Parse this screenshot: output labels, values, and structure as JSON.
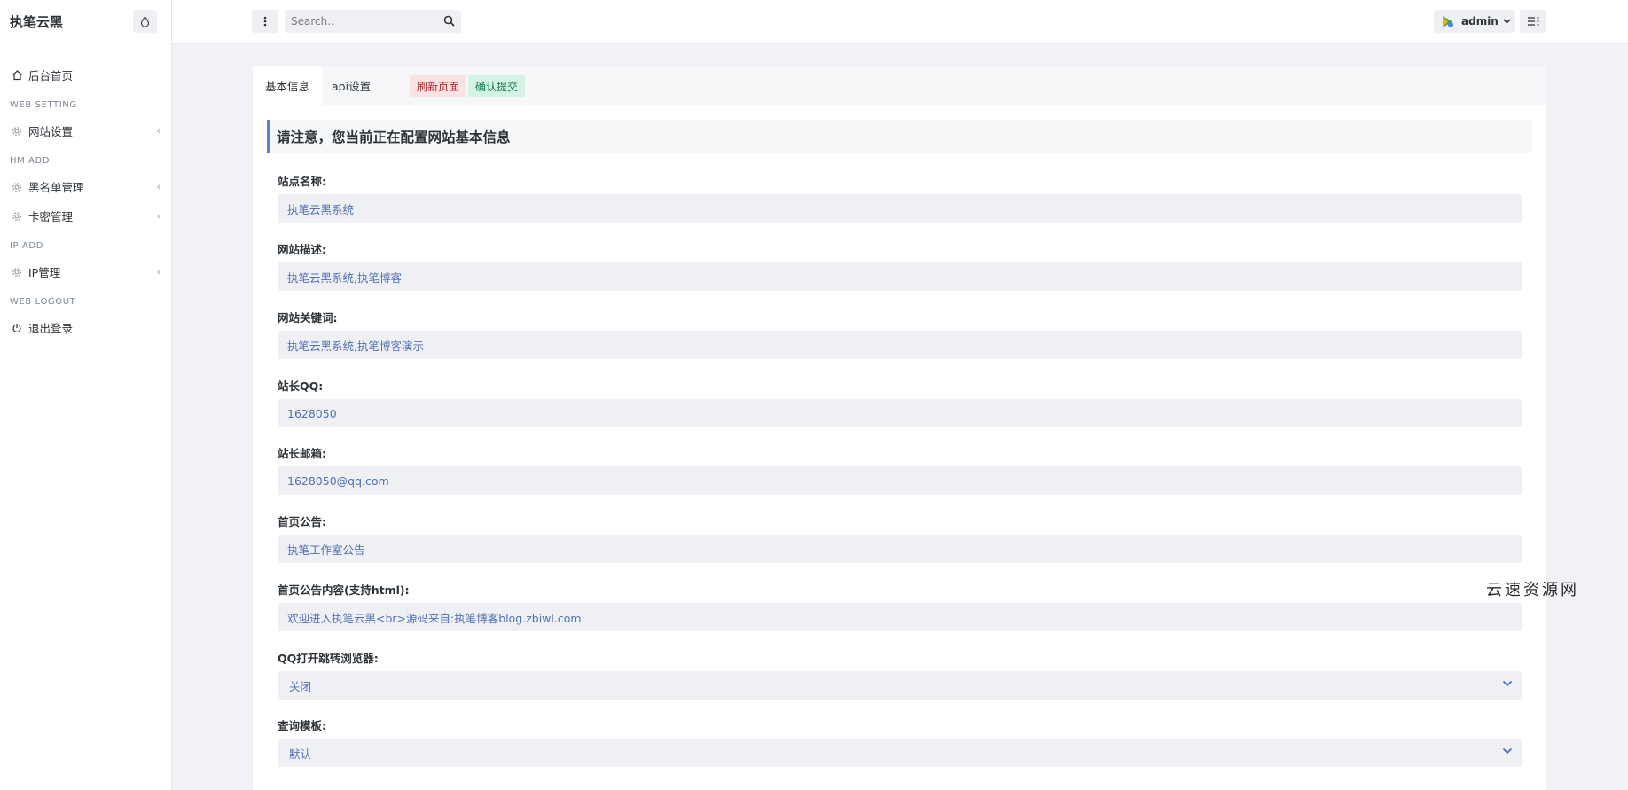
{
  "sidebar": {
    "brand": "执笔云黑",
    "home_label": "后台首页",
    "sections": [
      {
        "header": "WEB SETTING",
        "items": [
          "网站设置"
        ]
      },
      {
        "header": "HM ADD",
        "items": [
          "黑名单管理",
          "卡密管理"
        ]
      },
      {
        "header": "IP ADD",
        "items": [
          "IP管理"
        ]
      },
      {
        "header": "WEB LOGOUT",
        "items": [
          "退出登录"
        ]
      }
    ]
  },
  "topbar": {
    "search_placeholder": "Search..",
    "user_name": "admin"
  },
  "card": {
    "tabs": [
      "基本信息",
      "api设置"
    ],
    "refresh_label": "刷新页面",
    "submit_label": "确认提交",
    "notice": "请注意，您当前正在配置网站基本信息",
    "fields": [
      {
        "label": "站点名称:",
        "value": "执笔云黑系统"
      },
      {
        "label": "网站描述:",
        "value": "执笔云黑系统,执笔博客"
      },
      {
        "label": "网站关键词:",
        "value": "执笔云黑系统,执笔博客演示"
      },
      {
        "label": "站长QQ:",
        "value": "1628050"
      },
      {
        "label": "站长邮箱:",
        "value": "1628050@qq.com"
      },
      {
        "label": "首页公告:",
        "value": "执笔工作室公告"
      },
      {
        "label": "首页公告内容(支持html):",
        "value": "欢迎进入执笔云黑<br>源码来自:执笔博客blog.zbiwl.com"
      },
      {
        "label": "QQ打开跳转浏览器:",
        "value": "关闭"
      },
      {
        "label": "查询模板:",
        "value": "默认"
      }
    ]
  },
  "watermark": "云速资源网",
  "colors": {
    "accent": "#5c80d1",
    "danger_bg": "#fbe3e4",
    "danger_text": "#b0242b",
    "success_bg": "#d4f3e6",
    "success_text": "#137a4b"
  }
}
